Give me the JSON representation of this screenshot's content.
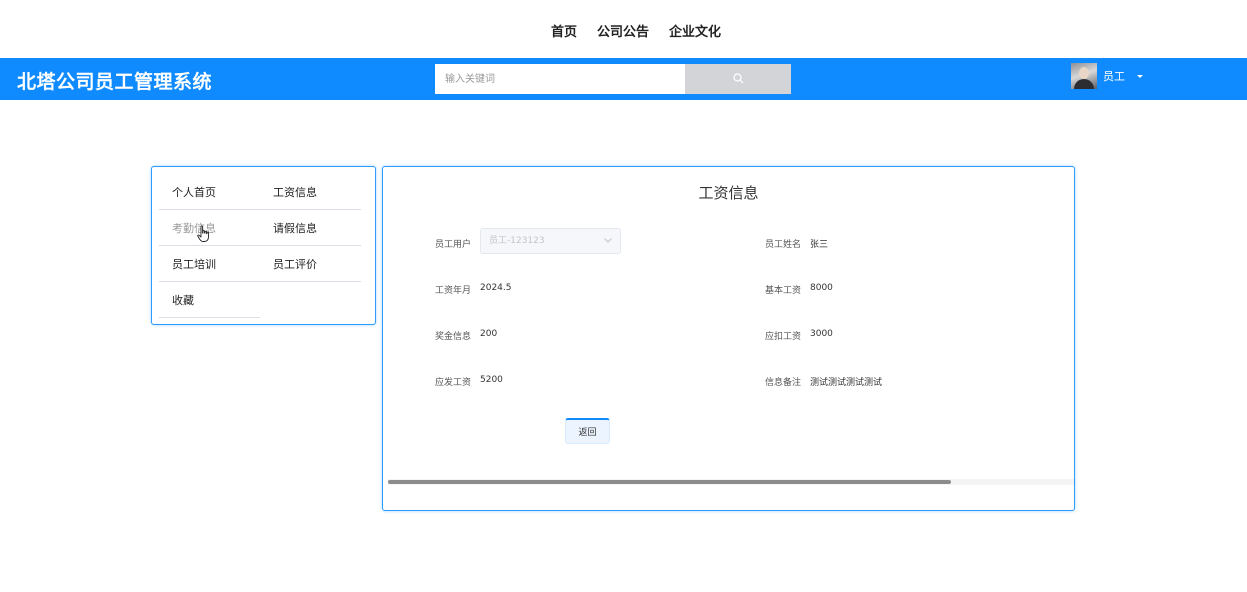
{
  "topnav": {
    "links": [
      "首页",
      "公司公告",
      "企业文化"
    ]
  },
  "header": {
    "title": "北塔公司员工管理系统",
    "search_placeholder": "输入关键词",
    "user_name": "员工"
  },
  "menu": {
    "items": [
      "个人首页",
      "工资信息",
      "考勤信息",
      "请假信息",
      "员工培训",
      "员工评价",
      "收藏"
    ]
  },
  "panel": {
    "title": "工资信息",
    "fields": {
      "employee_user": {
        "label": "员工用户",
        "value": "员工-123123"
      },
      "employee_name": {
        "label": "员工姓名",
        "value": "张三"
      },
      "salary_month": {
        "label": "工资年月",
        "value": "2024.5"
      },
      "base_salary": {
        "label": "基本工资",
        "value": "8000"
      },
      "bonus": {
        "label": "奖金信息",
        "value": "200"
      },
      "deduction": {
        "label": "应扣工资",
        "value": "3000"
      },
      "net_salary": {
        "label": "应发工资",
        "value": "5200"
      },
      "remark": {
        "label": "信息备注",
        "value": "测试测试测试测试"
      }
    },
    "back_label": "返回",
    "scroll_position": 0.82
  },
  "colors": {
    "brand": "#0f8bff",
    "border_accent": "#2e9bff"
  }
}
